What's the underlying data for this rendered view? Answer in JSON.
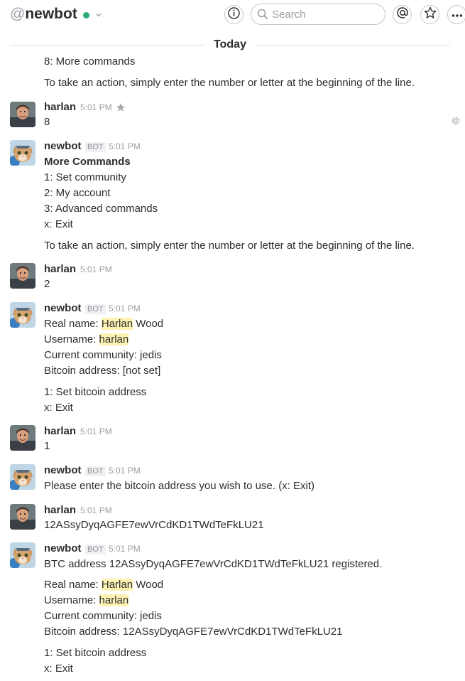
{
  "header": {
    "at": "@",
    "channel_name": "newbot",
    "search_placeholder": "Search"
  },
  "day_divider": "Today",
  "prev": {
    "line_more_commands": "8: More commands",
    "hint": "To take an action, simply enter the number or letter at the beginning of the line."
  },
  "m1": {
    "sender": "harlan",
    "time": "5:01 PM",
    "text": "8"
  },
  "m2": {
    "sender": "newbot",
    "badge": "BOT",
    "time": "5:01 PM",
    "title": "More Commands",
    "opt1": "1: Set community",
    "opt2": "2: My account",
    "opt3": "3: Advanced commands",
    "optx": "x: Exit",
    "hint": "To take an action, simply enter the number or letter at the beginning of the line."
  },
  "m3": {
    "sender": "harlan",
    "time": "5:01 PM",
    "text": "2"
  },
  "m4": {
    "sender": "newbot",
    "badge": "BOT",
    "time": "5:01 PM",
    "real_name_label": "Real name: ",
    "real_first": "Harlan",
    "real_last": " Wood",
    "username_label": "Username: ",
    "username": "harlan",
    "community": "Current community: jedis",
    "bitcoin": "Bitcoin address: [not set]",
    "opt1": "1: Set bitcoin address",
    "optx": "x: Exit"
  },
  "m5": {
    "sender": "harlan",
    "time": "5:01 PM",
    "text": "1"
  },
  "m6": {
    "sender": "newbot",
    "badge": "BOT",
    "time": "5:01 PM",
    "text": "Please enter the bitcoin address you wish to use. (x: Exit)"
  },
  "m7": {
    "sender": "harlan",
    "time": "5:01 PM",
    "text": "12ASsyDyqAGFE7ewVrCdKD1TWdTeFkLU21"
  },
  "m8": {
    "sender": "newbot",
    "badge": "BOT",
    "time": "5:01 PM",
    "registered": "BTC address 12ASsyDyqAGFE7ewVrCdKD1TWdTeFkLU21 registered.",
    "real_name_label": "Real name: ",
    "real_first": "Harlan",
    "real_last": " Wood",
    "username_label": "Username: ",
    "username": "harlan",
    "community": "Current community: jedis",
    "bitcoin": "Bitcoin address: 12ASsyDyqAGFE7ewVrCdKD1TWdTeFkLU21",
    "opt1": "1: Set bitcoin address",
    "optx": "x: Exit"
  },
  "icons": [
    "info-icon",
    "search-icon",
    "at-mention-icon",
    "star-icon",
    "more-icon",
    "star-message-icon",
    "gear-icon",
    "chevron-down-icon"
  ],
  "colors": {
    "presence": "#2bac76",
    "highlight": "#fdf2b1",
    "muted": "#9e9ea6"
  }
}
